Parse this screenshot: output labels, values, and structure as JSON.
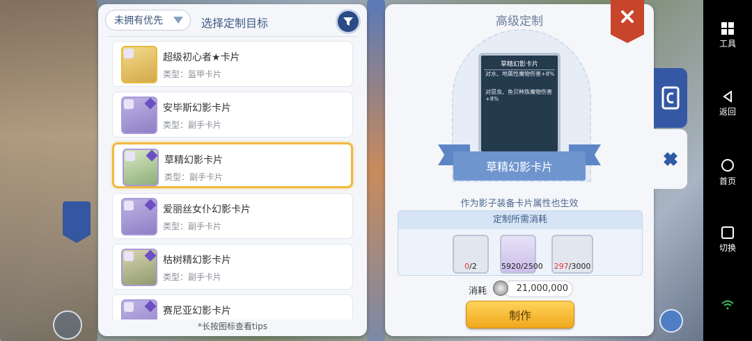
{
  "left_panel": {
    "filter_label": "未拥有优先",
    "title": "选择定制目标",
    "items": [
      {
        "name": "超级初心者★卡片",
        "type": "类型：盔甲卡片"
      },
      {
        "name": "安毕斯幻影卡片",
        "type": "类型：副手卡片"
      },
      {
        "name": "草精幻影卡片",
        "type": "类型：副手卡片"
      },
      {
        "name": "爱丽丝女仆幻影卡片",
        "type": "类型：副手卡片"
      },
      {
        "name": "枯树精幻影卡片",
        "type": "类型：副手卡片"
      },
      {
        "name": "赛尼亚幻影卡片",
        "type": ""
      }
    ],
    "hint": "*长按图标查看tips"
  },
  "right_panel": {
    "title": "高级定制",
    "card": {
      "name": "草精幻影卡片",
      "line1": "对水、地属性魔物伤害+8%",
      "line2": "对昆虫、鱼贝种族魔物伤害+8%"
    },
    "ribbon_label": "草精幻影卡片",
    "subtext": "作为影子装备卡片属性也生效",
    "cost_title": "定制所需消耗",
    "materials": [
      {
        "have": "0",
        "need": "/2"
      },
      {
        "have": "5920",
        "need": "/2500"
      },
      {
        "have": "297",
        "need": "/3000"
      }
    ],
    "consume_label": "消耗",
    "consume_value": "21,000,000",
    "make_label": "制作"
  },
  "navbar": {
    "tools": "工具",
    "back": "返回",
    "home": "首页",
    "switch": "切换"
  }
}
